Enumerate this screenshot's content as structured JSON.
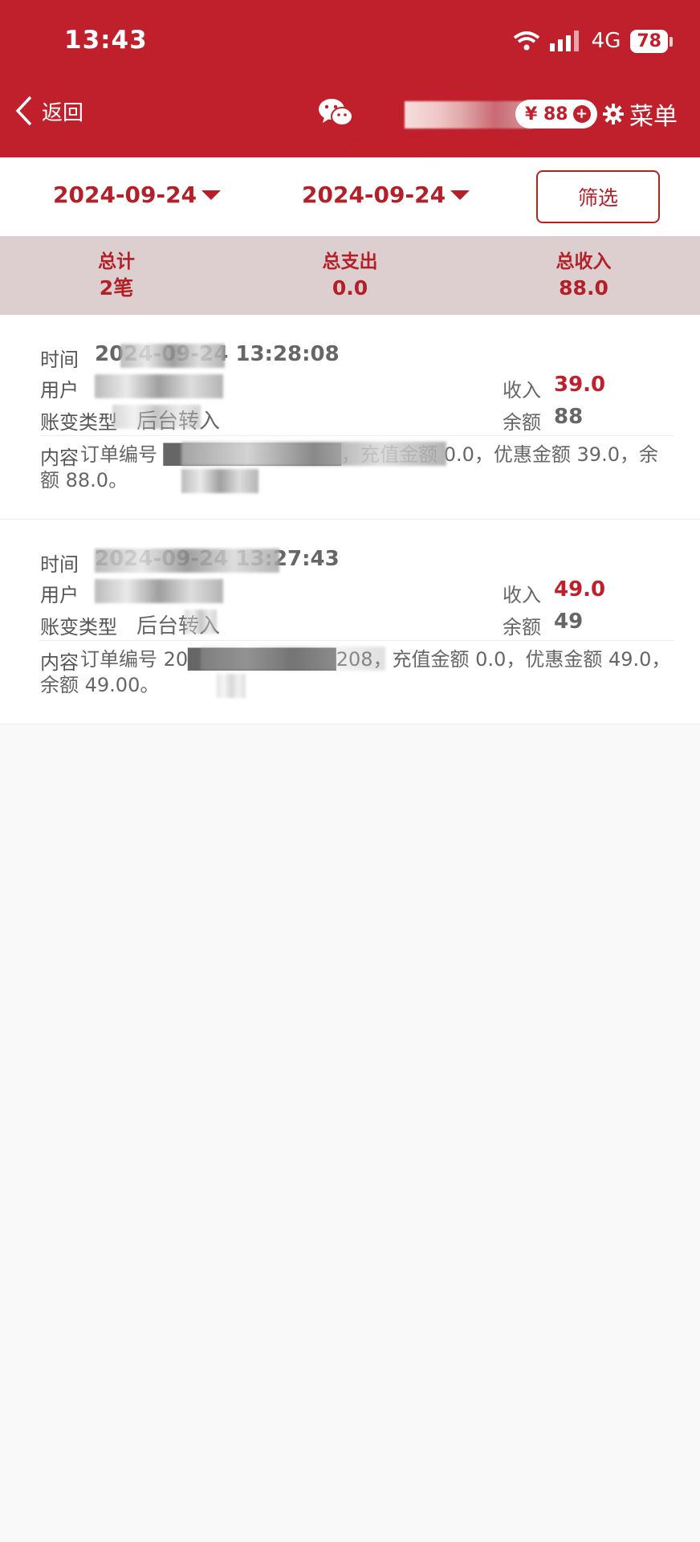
{
  "status_bar": {
    "time": "13:43",
    "network": "4G",
    "battery": "78"
  },
  "navbar": {
    "back_label": "返回",
    "balance": "¥ 88",
    "menu_label": "菜单"
  },
  "filters": {
    "start_date": "2024-09-24",
    "end_date": "2024-09-24",
    "filter_button": "筛选"
  },
  "summary": [
    {
      "label": "总计",
      "value": "2笔"
    },
    {
      "label": "总支出",
      "value": "0.0"
    },
    {
      "label": "总收入",
      "value": "88.0"
    }
  ],
  "labels": {
    "time": "时间",
    "user": "用户",
    "type": "账变类型",
    "content": "内容",
    "income": "收入",
    "balance": "余额"
  },
  "records": [
    {
      "time": "2024-09-24 13:28:08",
      "user": "",
      "income": "39.0",
      "type": "后台转入",
      "balance": "88",
      "content": "订单编号 ████████████，充值金额 0.0，优惠金额 39.0，余额 88.0。"
    },
    {
      "time": "2024-09-24 13:27:43",
      "user": "",
      "income": "49.0",
      "type": "后台转入",
      "balance": "49",
      "content": "订单编号 20██████████208，充值金额 0.0，优惠金额 49.0，余额 49.00。"
    }
  ],
  "colors": {
    "brand_red": "#c0202b",
    "summary_bg": "#ddcfcf",
    "page_bg": "#f9f9f9"
  }
}
